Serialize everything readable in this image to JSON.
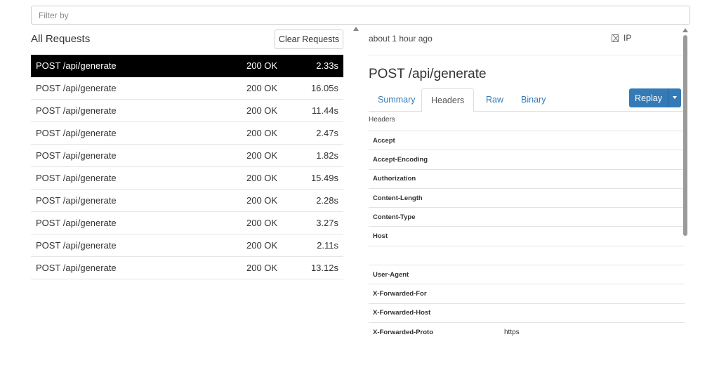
{
  "filter": {
    "placeholder": "Filter by"
  },
  "left": {
    "title": "All Requests",
    "clear_label": "Clear Requests",
    "requests": [
      {
        "name": "POST /api/generate",
        "status": "200 OK",
        "time": "2.33s",
        "active": true
      },
      {
        "name": "POST /api/generate",
        "status": "200 OK",
        "time": "16.05s"
      },
      {
        "name": "POST /api/generate",
        "status": "200 OK",
        "time": "11.44s"
      },
      {
        "name": "POST /api/generate",
        "status": "200 OK",
        "time": "2.47s"
      },
      {
        "name": "POST /api/generate",
        "status": "200 OK",
        "time": "1.82s"
      },
      {
        "name": "POST /api/generate",
        "status": "200 OK",
        "time": "15.49s"
      },
      {
        "name": "POST /api/generate",
        "status": "200 OK",
        "time": "2.28s"
      },
      {
        "name": "POST /api/generate",
        "status": "200 OK",
        "time": "3.27s"
      },
      {
        "name": "POST /api/generate",
        "status": "200 OK",
        "time": "2.11s"
      },
      {
        "name": "POST /api/generate",
        "status": "200 OK",
        "time": "13.12s"
      }
    ]
  },
  "detail": {
    "time_ago": "about 1 hour ago",
    "ip_label": "IP",
    "heading": "POST /api/generate",
    "tabs": [
      "Summary",
      "Headers",
      "Raw",
      "Binary"
    ],
    "active_tab": "Headers",
    "replay_label": "Replay",
    "headers_label": "Headers",
    "headers": [
      {
        "key": "Accept",
        "value": ""
      },
      {
        "key": "Accept-Encoding",
        "value": ""
      },
      {
        "key": "Authorization",
        "value": ""
      },
      {
        "key": "Content-Length",
        "value": ""
      },
      {
        "key": "Content-Type",
        "value": ""
      },
      {
        "key": "Host",
        "value": ""
      },
      {
        "key": "",
        "value": ""
      },
      {
        "key": "User-Agent",
        "value": ""
      },
      {
        "key": "X-Forwarded-For",
        "value": ""
      },
      {
        "key": "X-Forwarded-Host",
        "value": ""
      },
      {
        "key": "X-Forwarded-Proto",
        "value": "https"
      }
    ]
  },
  "colors": {
    "accent": "#337ab7",
    "active_row_bg": "#000000",
    "link": "#337ab7"
  }
}
